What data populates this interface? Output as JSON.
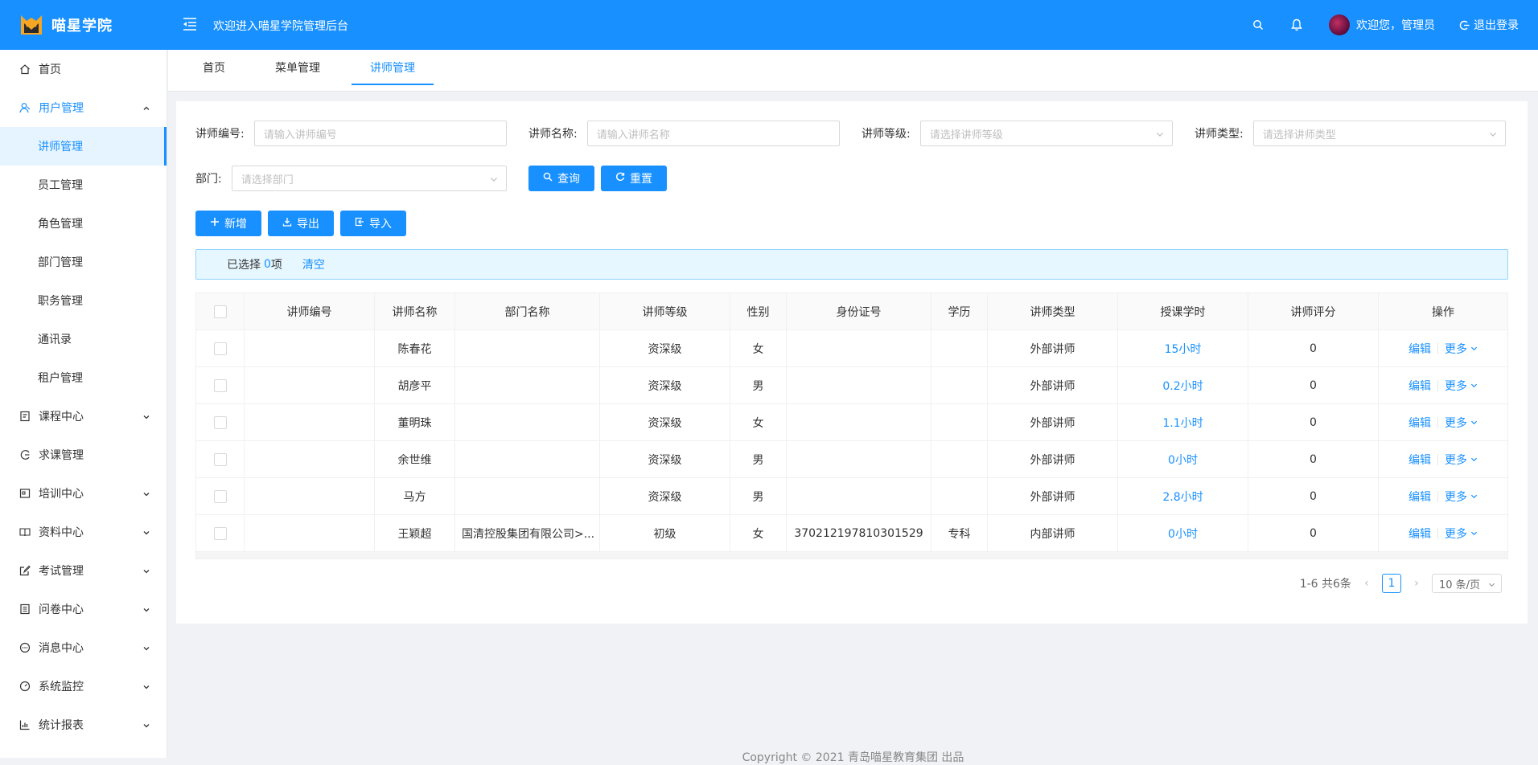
{
  "brand": {
    "name": "喵星学院",
    "color": "#1890ff"
  },
  "header": {
    "welcome": "欢迎进入喵星学院管理后台",
    "greeting": "欢迎您，管理员",
    "logout": "退出登录"
  },
  "sidebar": {
    "items": [
      {
        "label": "首页",
        "icon": "home-icon"
      },
      {
        "label": "用户管理",
        "icon": "user-icon",
        "open": true,
        "children": [
          "讲师管理",
          "员工管理",
          "角色管理",
          "部门管理",
          "职务管理",
          "通讯录",
          "租户管理"
        ]
      },
      {
        "label": "课程中心",
        "icon": "course-icon"
      },
      {
        "label": "求课管理",
        "icon": "request-icon"
      },
      {
        "label": "培训中心",
        "icon": "training-icon"
      },
      {
        "label": "资料中心",
        "icon": "book-icon"
      },
      {
        "label": "考试管理",
        "icon": "exam-icon"
      },
      {
        "label": "问卷中心",
        "icon": "survey-icon"
      },
      {
        "label": "消息中心",
        "icon": "message-icon"
      },
      {
        "label": "系统监控",
        "icon": "monitor-icon"
      },
      {
        "label": "统计报表",
        "icon": "chart-icon"
      }
    ],
    "active_child": "讲师管理"
  },
  "tabs": [
    "首页",
    "菜单管理",
    "讲师管理"
  ],
  "active_tab": "讲师管理",
  "filters": {
    "code": {
      "label": "讲师编号:",
      "placeholder": "请输入讲师编号"
    },
    "name": {
      "label": "讲师名称:",
      "placeholder": "请输入讲师名称"
    },
    "level": {
      "label": "讲师等级:",
      "placeholder": "请选择讲师等级"
    },
    "type": {
      "label": "讲师类型:",
      "placeholder": "请选择讲师类型"
    },
    "dept": {
      "label": "部门:",
      "placeholder": "请选择部门"
    },
    "search_btn": "查询",
    "reset_btn": "重置"
  },
  "toolbar": {
    "add": "新增",
    "export": "导出",
    "import": "导入"
  },
  "selection": {
    "prefix": "已选择",
    "count": "0",
    "suffix": "项",
    "clear": "清空"
  },
  "table": {
    "columns": [
      "讲师编号",
      "讲师名称",
      "部门名称",
      "讲师等级",
      "性别",
      "身份证号",
      "学历",
      "讲师类型",
      "授课学时",
      "讲师评分",
      "操作"
    ],
    "rows": [
      {
        "code": "",
        "name": "陈春花",
        "dept": "",
        "level": "资深级",
        "gender": "女",
        "id": "",
        "edu": "",
        "type": "外部讲师",
        "hours": "15小时",
        "score": "0"
      },
      {
        "code": "",
        "name": "胡彦平",
        "dept": "",
        "level": "资深级",
        "gender": "男",
        "id": "",
        "edu": "",
        "type": "外部讲师",
        "hours": "0.2小时",
        "score": "0"
      },
      {
        "code": "",
        "name": "董明珠",
        "dept": "",
        "level": "资深级",
        "gender": "女",
        "id": "",
        "edu": "",
        "type": "外部讲师",
        "hours": "1.1小时",
        "score": "0"
      },
      {
        "code": "",
        "name": "余世维",
        "dept": "",
        "level": "资深级",
        "gender": "男",
        "id": "",
        "edu": "",
        "type": "外部讲师",
        "hours": "0小时",
        "score": "0"
      },
      {
        "code": "",
        "name": "马方",
        "dept": "",
        "level": "资深级",
        "gender": "男",
        "id": "",
        "edu": "",
        "type": "外部讲师",
        "hours": "2.8小时",
        "score": "0"
      },
      {
        "code": "",
        "name": "王颖超",
        "dept": "国清控股集团有限公司>...",
        "level": "初级",
        "gender": "女",
        "id": "370212197810301529",
        "edu": "专科",
        "type": "内部讲师",
        "hours": "0小时",
        "score": "0"
      }
    ],
    "edit": "编辑",
    "more": "更多"
  },
  "pagination": {
    "summary": "1-6 共6条",
    "page": "1",
    "size": "10 条/页"
  },
  "footer": "Copyright © 2021 青岛喵星教育集团 出品"
}
